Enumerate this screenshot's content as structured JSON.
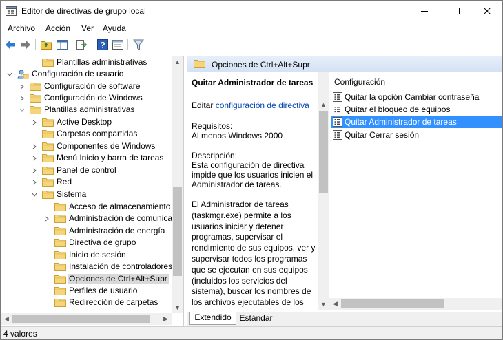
{
  "window": {
    "title": "Editor de directivas de grupo local"
  },
  "menu": [
    "Archivo",
    "Acción",
    "Ver",
    "Ayuda"
  ],
  "tree": [
    {
      "label": "Plantillas administrativas"
    },
    {
      "label": "Configuración de usuario"
    },
    {
      "label": "Configuración de software"
    },
    {
      "label": "Configuración de Windows"
    },
    {
      "label": "Plantillas administrativas"
    },
    {
      "label": "Active Desktop"
    },
    {
      "label": "Carpetas compartidas"
    },
    {
      "label": "Componentes de Windows"
    },
    {
      "label": "Menú Inicio y barra de tareas"
    },
    {
      "label": "Panel de control"
    },
    {
      "label": "Red"
    },
    {
      "label": "Sistema"
    },
    {
      "label": "Acceso de almacenamiento e"
    },
    {
      "label": "Administración de comunica"
    },
    {
      "label": "Administración de energía"
    },
    {
      "label": "Directiva de grupo"
    },
    {
      "label": "Inicio de sesión"
    },
    {
      "label": "Instalación de controladores"
    },
    {
      "label": "Opciones de Ctrl+Alt+Supr"
    },
    {
      "label": "Perfiles de usuario"
    },
    {
      "label": "Redirección de carpetas"
    }
  ],
  "right": {
    "header": "Opciones de Ctrl+Alt+Supr",
    "policy_title": "Quitar Administrador de tareas",
    "edit_prefix": "Editar",
    "edit_link": "configuración de directiva",
    "requirements_label": "Requisitos:",
    "requirements_value": "Al menos Windows 2000",
    "description_label": "Descripción:",
    "description_p1": "Esta configuración de directiva impide que los usuarios inicien el Administrador de tareas.",
    "description_p2": "El Administrador de tareas (taskmgr.exe) permite a los usuarios iniciar y detener programas, supervisar el rendimiento de sus equipos, ver y supervisar todos los programas que se ejecutan en sus equipos (incluidos los servicios del sistema), buscar los nombres de los archivos ejecutables de los programas y cambiar la prioridad",
    "column_header": "Configuración",
    "items": [
      {
        "label": "Quitar la opción Cambiar contraseña"
      },
      {
        "label": "Quitar el bloqueo de equipos"
      },
      {
        "label": "Quitar Administrador de tareas"
      },
      {
        "label": "Quitar Cerrar sesión"
      }
    ],
    "tabs": [
      "Extendido",
      "Estándar"
    ]
  },
  "status": {
    "text": "4 valores"
  }
}
